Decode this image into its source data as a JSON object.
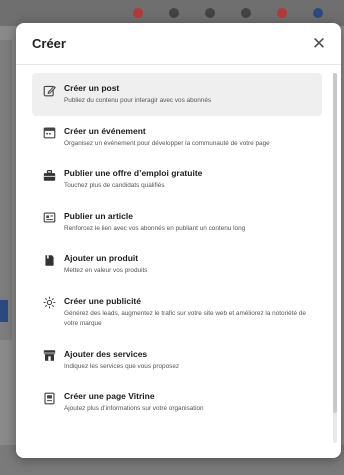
{
  "modal": {
    "title": "Créer",
    "close_symbol": "✕"
  },
  "options": [
    {
      "title": "Créer un post",
      "description": "Publiez du contenu pour interagir avec vos abonnés",
      "icon": "pencil-square-icon"
    },
    {
      "title": "Créer un événement",
      "description": "Organisez un événement pour développer la communauté de votre page",
      "icon": "calendar-icon"
    },
    {
      "title": "Publier une offre d’emploi gratuite",
      "description": "Touchez plus de candidats qualifiés",
      "icon": "briefcase-icon"
    },
    {
      "title": "Publier un article",
      "description": "Renforcez le lien avec vos abonnés en publiant un contenu long",
      "icon": "article-icon"
    },
    {
      "title": "Ajouter un produit",
      "description": "Mettez en valeur vos produits",
      "icon": "product-box-icon"
    },
    {
      "title": "Créer une publicité",
      "description": "Générez des leads, augmentez le trafic sur votre site web et améliorez la notoriété de votre marque",
      "icon": "sun-burst-icon"
    },
    {
      "title": "Ajouter des services",
      "description": "Indiquez les services que vous proposez",
      "icon": "storefront-icon"
    },
    {
      "title": "Créer une page Vitrine",
      "description": "Ajoutez plus d’informations sur votre organisation",
      "icon": "showcase-page-icon"
    }
  ],
  "colors": {
    "overlay": "#8a8a8a",
    "modal_bg": "#ffffff",
    "active_row": "#efefef",
    "icon_color": "#444444"
  }
}
